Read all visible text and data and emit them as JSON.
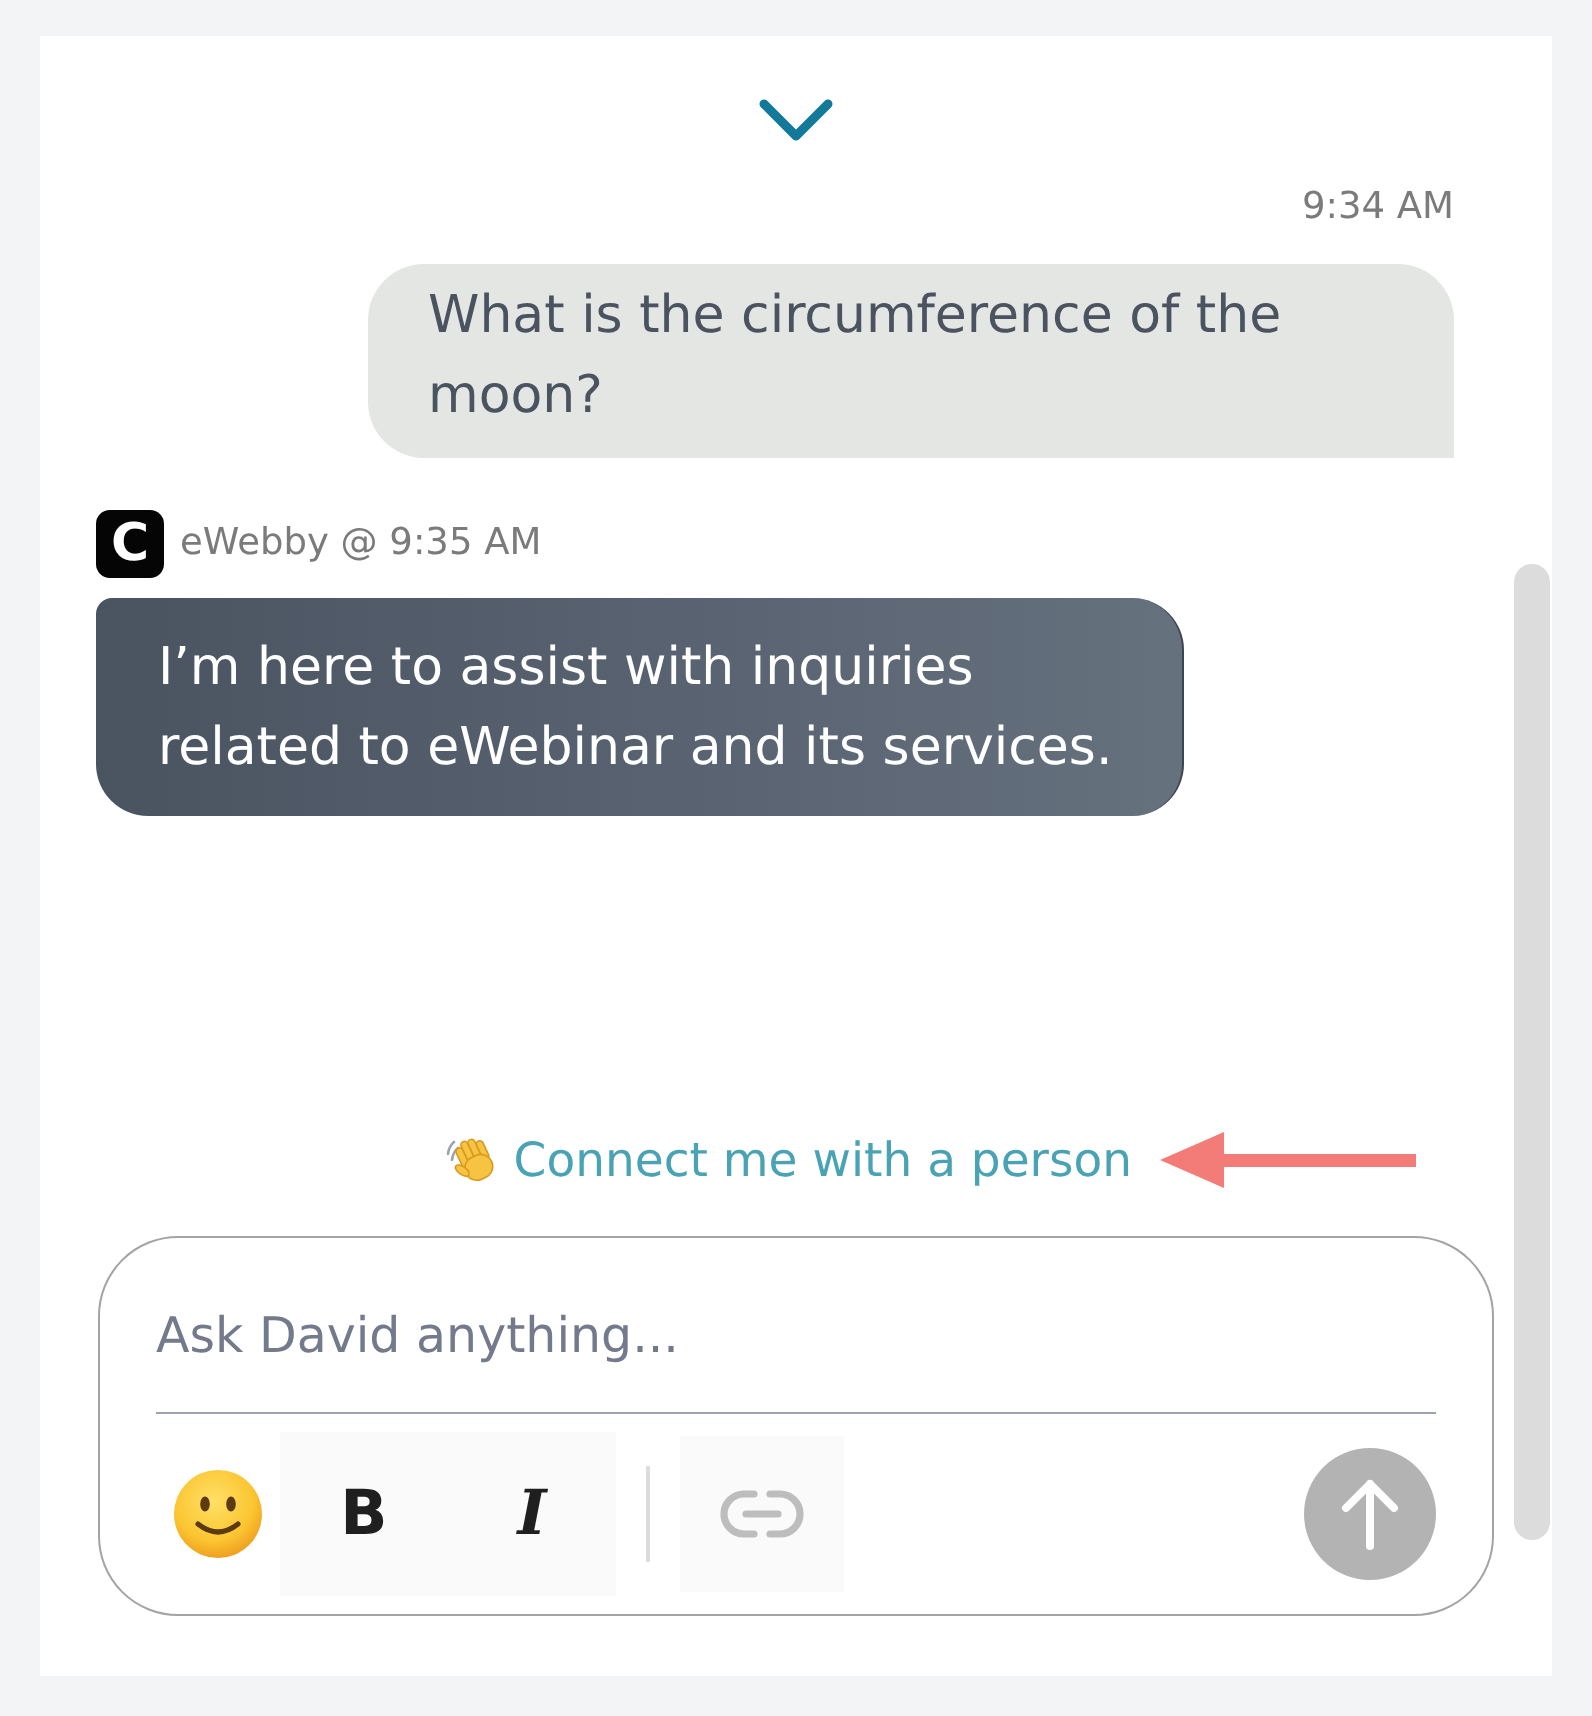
{
  "messages": [
    {
      "kind": "user",
      "meta": "9:34 AM",
      "text": "What is the circumference of the moon?"
    },
    {
      "kind": "bot",
      "avatar": "C",
      "meta": "eWebby @ 9:35 AM",
      "text": "I’m here to assist with inquiries related to eWebinar and its services."
    }
  ],
  "connect_link": {
    "label": "Connect me with a person"
  },
  "composer": {
    "placeholder": "Ask David anything...",
    "tools": [
      {
        "kind": "emoji"
      },
      {
        "kind": "bold",
        "label": "B",
        "disabled": false
      },
      {
        "kind": "italic",
        "label": "I",
        "disabled": false
      },
      {
        "kind": "link",
        "disabled": true
      }
    ],
    "send": {
      "disabled": true
    }
  }
}
